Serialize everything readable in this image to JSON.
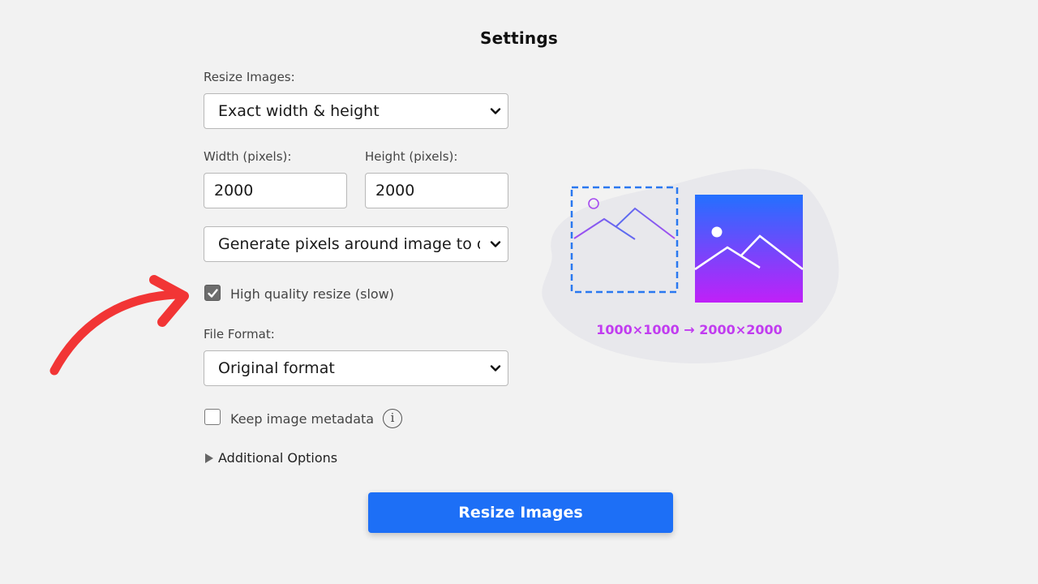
{
  "header": {
    "title": "Settings"
  },
  "resize": {
    "label": "Resize Images:",
    "mode_selected": "Exact width & height"
  },
  "dimensions": {
    "width_label": "Width (pixels):",
    "width_value": "2000",
    "height_label": "Height (pixels):",
    "height_value": "2000"
  },
  "fit": {
    "selected": "Generate pixels around image to ot"
  },
  "quality": {
    "label": "High quality resize (slow)",
    "checked": true
  },
  "format": {
    "label": "File Format:",
    "selected": "Original format"
  },
  "metadata": {
    "label": "Keep image metadata",
    "checked": false,
    "info_icon": "i"
  },
  "additional": {
    "label": "Additional Options",
    "expanded": false
  },
  "action": {
    "label": "Resize Images"
  },
  "illustration": {
    "caption": "1000×1000 → 2000×2000",
    "colors": {
      "dashed_frame": "#2a78f0",
      "gradient_top": "#2370ff",
      "gradient_bottom": "#c020f8",
      "caption": "#c13cf0"
    }
  },
  "annotation": {
    "arrow_color": "#f23535"
  },
  "colors": {
    "background": "#f2f2f2",
    "primary_button": "#1d6ff6"
  }
}
